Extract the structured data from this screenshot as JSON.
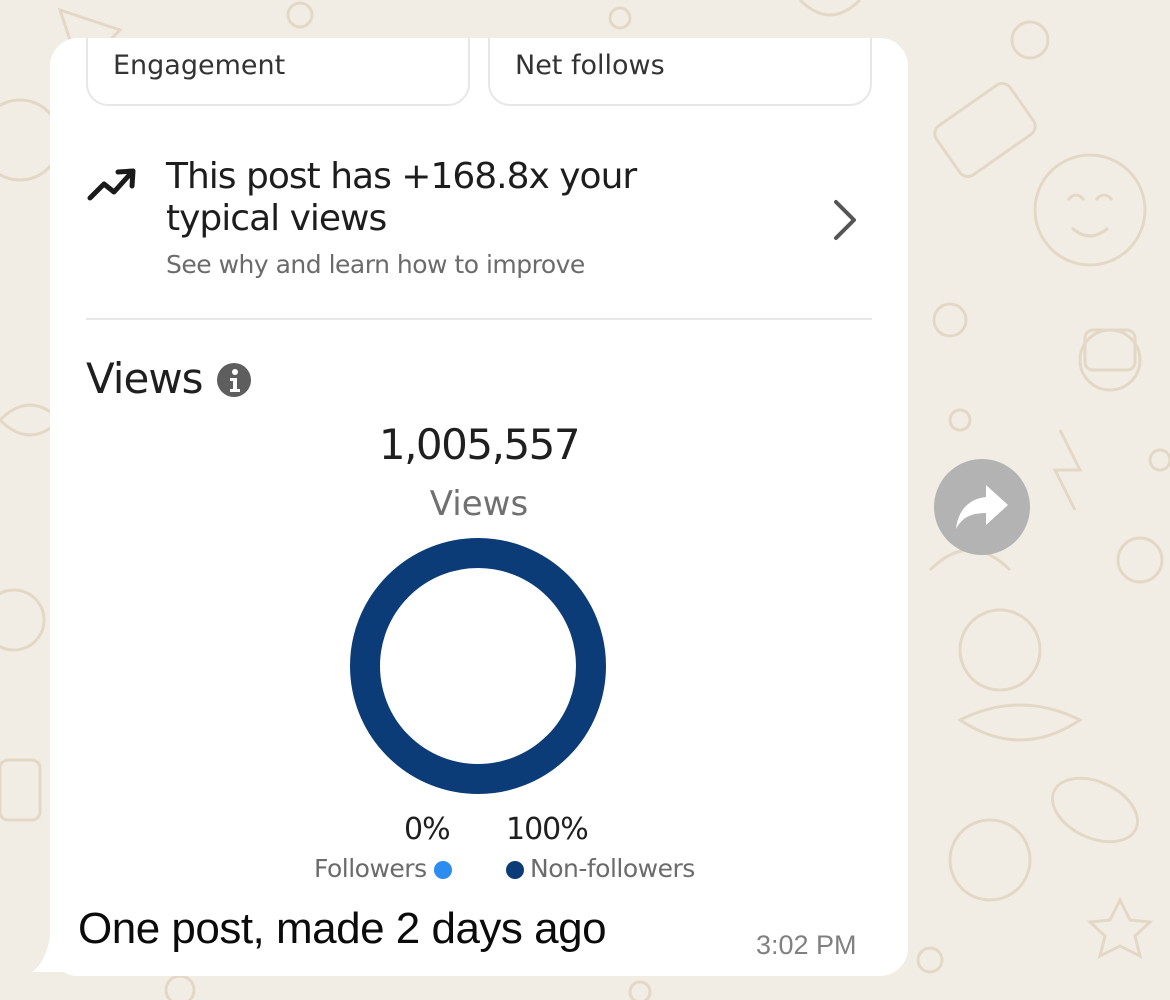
{
  "tabs": {
    "left_label": "Engagement",
    "right_label": "Net follows"
  },
  "insight": {
    "icon": "trending-up-icon",
    "title": "This post has +168.8x your typical views",
    "subtitle": "See why and learn how to improve"
  },
  "views": {
    "heading": "Views",
    "total": "1,005,557",
    "total_label": "Views"
  },
  "chart_data": {
    "type": "pie",
    "categories": [
      "Followers",
      "Non-followers"
    ],
    "values": [
      0,
      100
    ],
    "value_labels": [
      "0%",
      "100%"
    ],
    "colors": [
      "#2d8cf0",
      "#0c3c78"
    ],
    "legend": "bottom"
  },
  "message": {
    "caption": "One post, made 2 days ago",
    "time": "3:02 PM"
  },
  "colors": {
    "chat_background": "#f2ede4",
    "bubble": "#ffffff",
    "forward_button": "#b3b3b3"
  }
}
